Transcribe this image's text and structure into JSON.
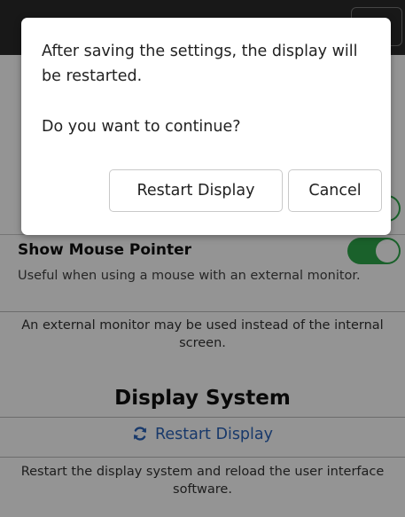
{
  "dialog": {
    "message": "After saving the settings, the display will be restarted.",
    "question": "Do you want to continue?",
    "restart_button": "Restart Display",
    "cancel_button": "Cancel"
  },
  "settings": {
    "mouse_pointer": {
      "title": "Show Mouse Pointer",
      "description": "Useful when using a mouse with an external monitor.",
      "enabled": true
    },
    "external_monitor_note": "An external monitor may be used instead of the internal screen."
  },
  "display_system": {
    "section_title": "Display System",
    "restart_link": "Restart Display",
    "restart_icon": "sync-icon",
    "restart_note": "Restart the display system and reload the user interface software."
  },
  "colors": {
    "accent_blue": "#2a63b8",
    "toggle_green": "#2ea84a",
    "overlay": "rgba(0,0,0,0.42)"
  }
}
